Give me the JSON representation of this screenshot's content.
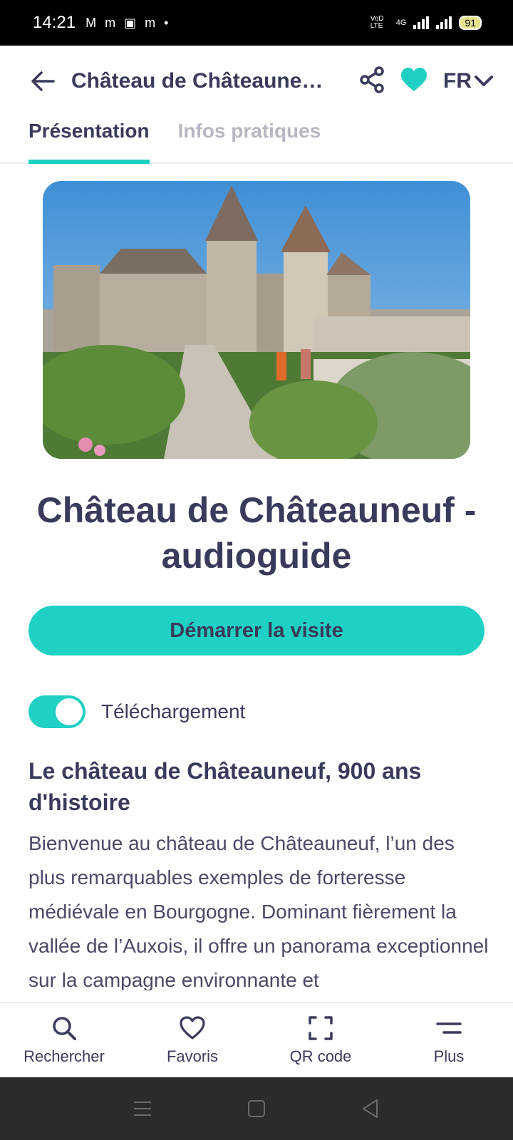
{
  "status_bar": {
    "time": "14:21",
    "battery": "91",
    "network": "4G",
    "volte": "VoD LTE"
  },
  "app_bar": {
    "title": "Château de Châteauneuf...",
    "language": "FR"
  },
  "tabs": [
    {
      "label": "Présentation",
      "active": true
    },
    {
      "label": "Infos pratiques",
      "active": false
    }
  ],
  "content": {
    "title": "Château de Châteauneuf - audioguide",
    "start_button": "Démarrer la visite",
    "download_toggle": {
      "label": "Téléchargement",
      "on": true
    },
    "section_title": "Le château de Châteauneuf, 900 ans d'histoire",
    "body": "Bienvenue au château de Châteauneuf, l’un des plus remarquables exemples de forteresse médiévale en Bourgogne. Dominant fièrement la vallée de l’Auxois, il offre un panorama exceptionnel sur la campagne environnante et"
  },
  "bottom_nav": [
    {
      "label": "Rechercher",
      "icon": "search-icon"
    },
    {
      "label": "Favoris",
      "icon": "heart-icon"
    },
    {
      "label": "QR code",
      "icon": "qr-scan-icon"
    },
    {
      "label": "Plus",
      "icon": "menu-icon"
    }
  ],
  "colors": {
    "accent": "#1fd1c4",
    "text": "#3a3a5c",
    "inactive": "#b7b7c2"
  }
}
